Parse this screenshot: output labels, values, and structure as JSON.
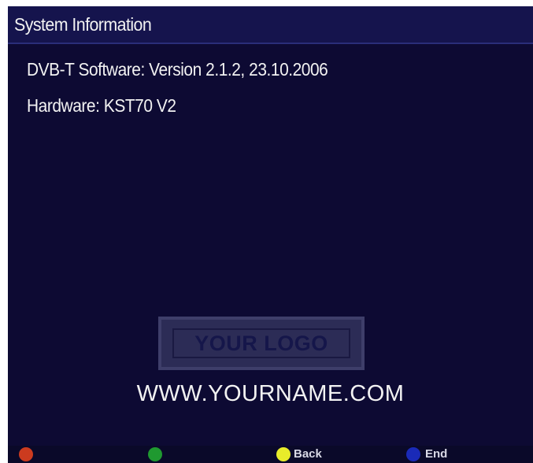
{
  "header": {
    "title": "System Information"
  },
  "info": {
    "software": "DVB-T Software: Version 2.1.2, 23.10.2006",
    "hardware": "Hardware: KST70 V2"
  },
  "branding": {
    "logo_text": "YOUR LOGO",
    "website": "WWW.YOURNAME.COM"
  },
  "footer": {
    "buttons": [
      {
        "color_name": "red",
        "color": "#cc3b1f",
        "label": ""
      },
      {
        "color_name": "green",
        "color": "#1f9930",
        "label": ""
      },
      {
        "color_name": "yellow",
        "color": "#e8ec2a",
        "label": "Back"
      },
      {
        "color_name": "blue",
        "color": "#1a2ab8",
        "label": "End"
      }
    ]
  },
  "colors": {
    "background": "#0d0a33",
    "title_bar": "#15144d",
    "text": "#f2f2f2"
  }
}
